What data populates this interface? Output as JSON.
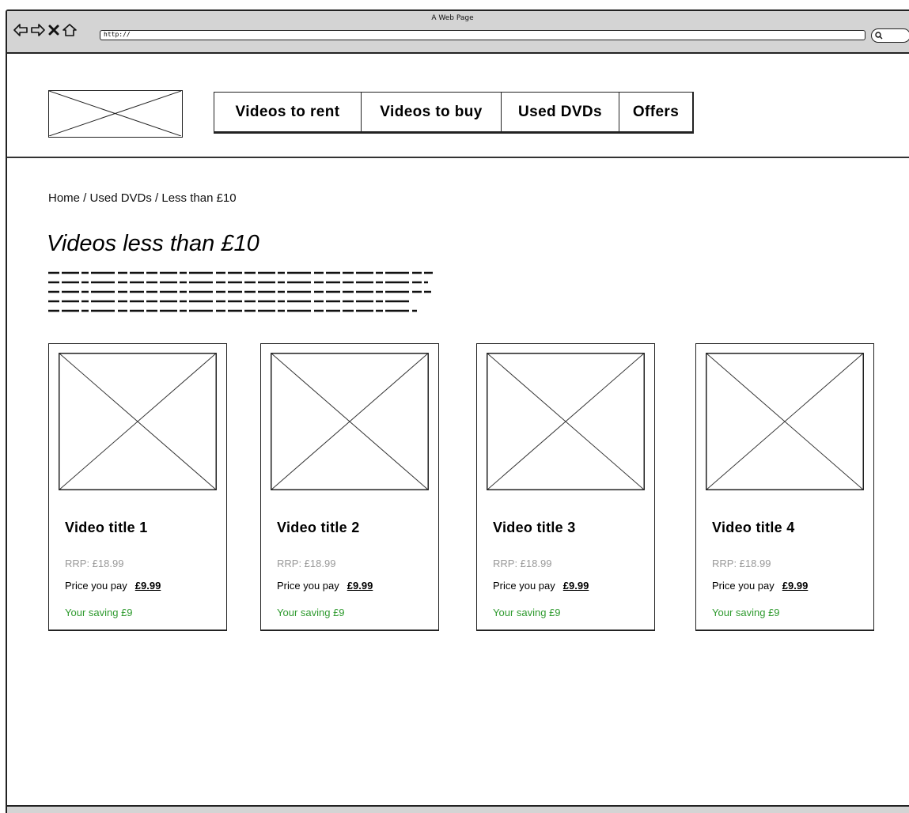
{
  "browser": {
    "window_title": "A Web Page",
    "url": "http://"
  },
  "nav": {
    "items": [
      {
        "label": "Videos to rent"
      },
      {
        "label": "Videos to buy"
      },
      {
        "label": "Used DVDs"
      },
      {
        "label": "Offers"
      }
    ]
  },
  "breadcrumb": "Home / Used DVDs / Less than £10",
  "page_title": "Videos less than £10",
  "products": [
    {
      "title": "Video title 1",
      "rrp": "RRP: £18.99",
      "price_label": "Price you pay",
      "price": "£9.99",
      "saving": "Your saving £9"
    },
    {
      "title": "Video title 2",
      "rrp": "RRP: £18.99",
      "price_label": "Price you pay",
      "price": "£9.99",
      "saving": "Your saving £9"
    },
    {
      "title": "Video title 3",
      "rrp": "RRP: £18.99",
      "price_label": "Price you pay",
      "price": "£9.99",
      "saving": "Your saving £9"
    },
    {
      "title": "Video title 4",
      "rrp": "RRP: £18.99",
      "price_label": "Price you pay",
      "price": "£9.99",
      "saving": "Your saving £9"
    }
  ],
  "colors": {
    "saving_text": "#2e9a2e",
    "rrp_text": "#9a9a9a",
    "chrome": "#d4d4d4"
  }
}
